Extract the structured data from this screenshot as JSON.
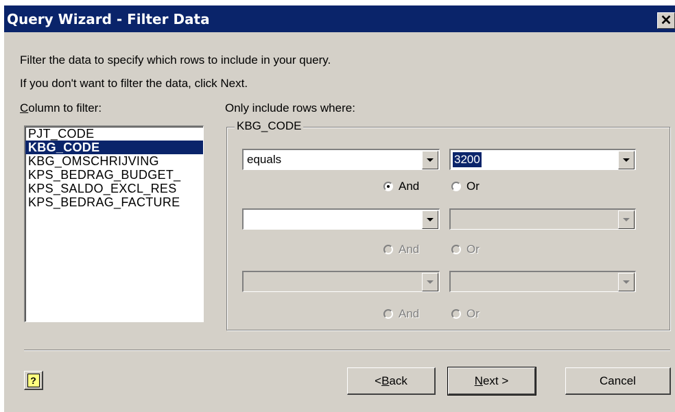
{
  "window": {
    "title": "Query Wizard - Filter Data",
    "close_glyph": "✕"
  },
  "intro": {
    "line1": "Filter the data to specify which rows to include in your query.",
    "line2": "If you don't want to filter the data, click Next."
  },
  "column_panel": {
    "label_accel": "C",
    "label_rest": "olumn to filter:",
    "items": [
      {
        "label": "PJT_CODE",
        "selected": false
      },
      {
        "label": "KBG_CODE",
        "selected": true
      },
      {
        "label": "KBG_OMSCHRIJVING",
        "selected": false
      },
      {
        "label": "KPS_BEDRAG_BUDGET_",
        "selected": false
      },
      {
        "label": "KPS_SALDO_EXCL_RES",
        "selected": false
      },
      {
        "label": "KPS_BEDRAG_FACTURE",
        "selected": false
      }
    ]
  },
  "criteria_panel": {
    "label": "Only include rows where:",
    "group_title": "KBG_CODE",
    "rows": [
      {
        "operator": "equals",
        "value": "3200",
        "and_label": "And",
        "or_label": "Or",
        "and_checked": true
      },
      {
        "operator": "",
        "value": "",
        "and_label": "And",
        "or_label": "Or",
        "and_checked": false
      },
      {
        "operator": "",
        "value": "",
        "and_label": "And",
        "or_label": "Or",
        "and_checked": false
      }
    ]
  },
  "buttons": {
    "back_prefix": "< ",
    "back_accel": "B",
    "back_rest": "ack",
    "next_accel": "N",
    "next_rest": "ext >",
    "cancel": "Cancel",
    "help_glyph": "?"
  },
  "icons": {
    "close": "close-icon",
    "dropdown": "chevron-down-icon",
    "help": "help-icon"
  }
}
